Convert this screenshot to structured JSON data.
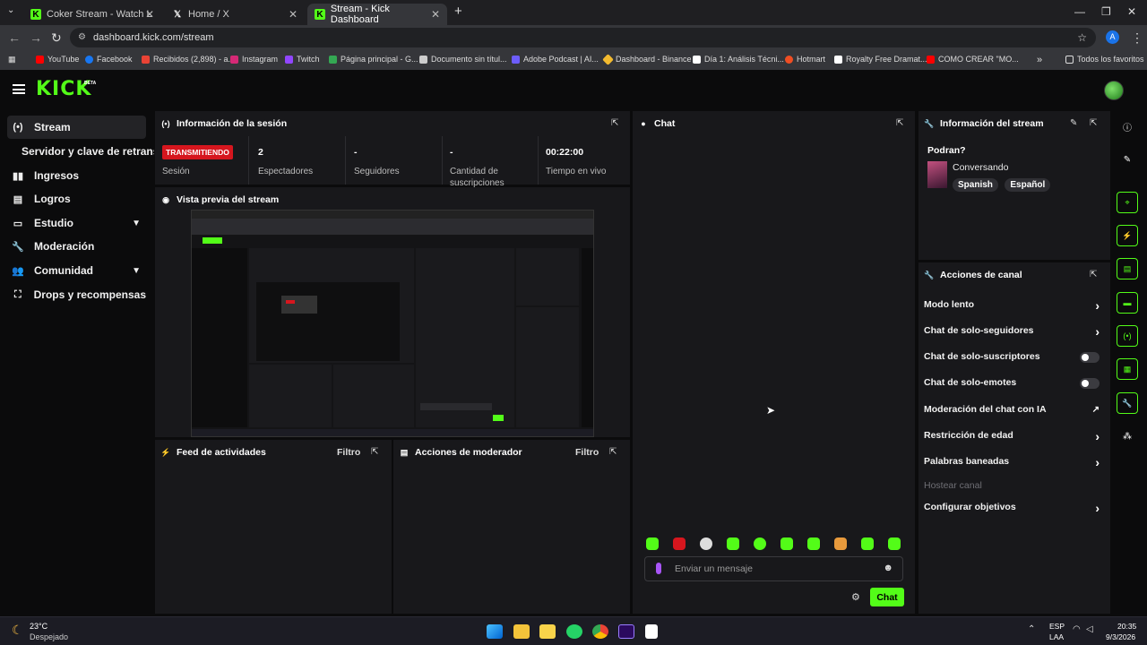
{
  "browser": {
    "tabs": [
      {
        "title": "Coker Stream - Watch Live on K",
        "icon": "kick-icon"
      },
      {
        "title": "Home / X",
        "icon": "x-icon"
      },
      {
        "title": "Stream - Kick Dashboard",
        "icon": "kick-icon"
      }
    ],
    "url": "dashboard.kick.com/stream",
    "profile_initial": "A",
    "bookmarks": [
      "YouTube",
      "Facebook",
      "Recibidos (2,898) - a...",
      "Instagram",
      "Twitch",
      "Página principal - G...",
      "Documento sin títul...",
      "Adobe Podcast | AI...",
      "Dashboard - Binance",
      "Día 1: Análisis Técni...",
      "Hotmart",
      "Royalty Free Dramat...",
      "COMO CREAR \"MO..."
    ],
    "all_bookmarks": "Todos los favoritos"
  },
  "header": {
    "logo": "KICK",
    "beta": "BETA"
  },
  "sidebar": {
    "items": [
      {
        "label": "Stream",
        "icon": "broadcast-icon"
      },
      {
        "label": "Servidor y clave de retransmisión",
        "icon": ""
      },
      {
        "label": "Ingresos",
        "icon": "money-icon"
      },
      {
        "label": "Logros",
        "icon": "trophy-icon"
      },
      {
        "label": "Estudio",
        "icon": "studio-icon"
      },
      {
        "label": "Moderación",
        "icon": "wrench-icon"
      },
      {
        "label": "Comunidad",
        "icon": "community-icon"
      },
      {
        "label": "Drops y recompensas",
        "icon": "drops-icon"
      }
    ]
  },
  "session": {
    "title": "Información de la sesión",
    "status_badge": "TRANSMITIENDO",
    "status_label": "Sesión",
    "stats": [
      {
        "value": "2",
        "label": "Espectadores"
      },
      {
        "value": "-",
        "label": "Seguidores"
      },
      {
        "value": "-",
        "label": "Cantidad de suscripciones"
      },
      {
        "value": "00:22:00",
        "label": "Tiempo en vivo"
      }
    ]
  },
  "preview": {
    "title": "Vista previa del stream"
  },
  "feed": {
    "title": "Feed de actividades",
    "filter": "Filtro"
  },
  "mod_actions": {
    "title": "Acciones de moderador",
    "filter": "Filtro"
  },
  "chat": {
    "title": "Chat",
    "placeholder": "Enviar un mensaje",
    "send_label": "Chat"
  },
  "stream_info": {
    "title": "Información del stream",
    "stream_title": "Podran?",
    "category": "Conversando",
    "tags": [
      "Spanish",
      "Español"
    ]
  },
  "channel_actions": {
    "title": "Acciones de canal",
    "items": [
      {
        "label": "Modo lento",
        "control": "arrow"
      },
      {
        "label": "Chat de solo-seguidores",
        "control": "arrow"
      },
      {
        "label": "Chat de solo-suscriptores",
        "control": "toggle"
      },
      {
        "label": "Chat de solo-emotes",
        "control": "toggle"
      },
      {
        "label": "Moderación del chat con IA",
        "control": "external"
      },
      {
        "label": "Restricción de edad",
        "control": "arrow"
      },
      {
        "label": "Palabras baneadas",
        "control": "arrow"
      },
      {
        "label": "Hostear canal",
        "control": "disabled"
      },
      {
        "label": "Configurar objetivos",
        "control": "arrow"
      }
    ],
    "toggle_states": {
      "solo_suscriptores": false,
      "solo_emotes": false
    }
  },
  "taskbar": {
    "weather_temp": "23°C",
    "weather_desc": "Despejado",
    "lang_top": "ESP",
    "lang_bottom": "LAA",
    "time": "20:35",
    "date": "9/3/2026"
  },
  "colors": {
    "accent": "#53fc18",
    "live": "#d6161e",
    "panel": "#18181b",
    "bg": "#0b0b0c"
  }
}
